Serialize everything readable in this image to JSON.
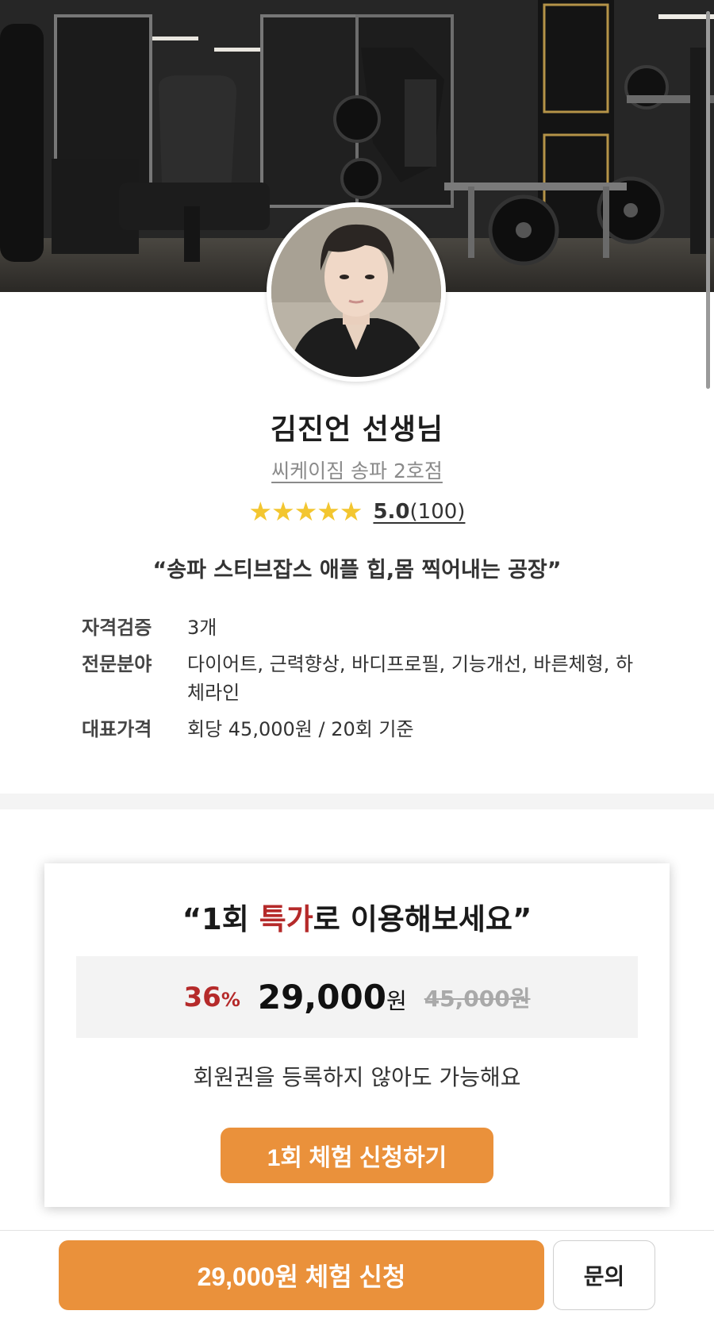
{
  "trainer": {
    "name": "김진언 선생님",
    "gym": "씨케이짐 송파 2호점",
    "stars": "★★★★★",
    "rating": "5.0",
    "review_count": "(100)",
    "quote": "“송파 스티브잡스 애플 힙,몸 찍어내는 공장”"
  },
  "info": [
    {
      "label": "자격검증",
      "value": "3개"
    },
    {
      "label": "전문분야",
      "value": "다이어트, 근력향상, 바디프로필, 기능개선, 바른체형, 하체라인"
    },
    {
      "label": "대표가격",
      "value": "회당 45,000원 / 20회 기준"
    }
  ],
  "promo": {
    "title_pre": "“1회 ",
    "title_accent": "특가",
    "title_post": "로 이용해보세요”",
    "discount_num": "36",
    "discount_unit": "%",
    "sale_price": "29,000",
    "sale_unit": "원",
    "original_price": "45,000원",
    "note": "회원권을 등록하지 않아도 가능해요",
    "button_label": "1회 체험 신청하기"
  },
  "bottom_bar": {
    "cta_label": "29,000원 체험 신청",
    "ask_label": "문의"
  },
  "colors": {
    "accent_orange": "#ea913b",
    "accent_red": "#b52a2a",
    "star_yellow": "#f3c630"
  }
}
